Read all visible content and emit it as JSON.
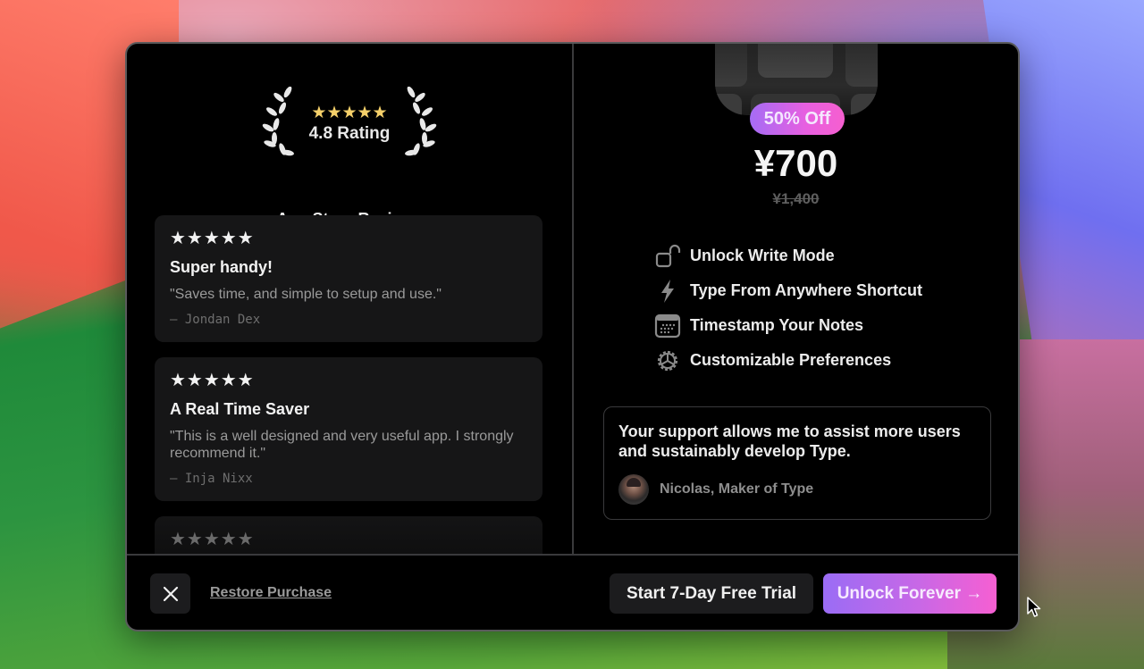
{
  "rating": {
    "stars": "★★★★★",
    "star_color": "#f5d06a",
    "value_label": "4.8 Rating",
    "source_label": "App Store Reviews"
  },
  "reviews": [
    {
      "stars": "★★★★★",
      "title": "Super handy!",
      "body": "\"Saves time, and simple to setup and use.\"",
      "author": "— Jondan Dex"
    },
    {
      "stars": "★★★★★",
      "title": "A Real Time Saver",
      "body": "\"This is a well designed and very useful app. I strongly recommend it.\"",
      "author": "— Inja Nixx"
    },
    {
      "stars": "★★★★★"
    }
  ],
  "offer": {
    "badge": "50% Off",
    "price": "¥700",
    "original_price": "¥1,400",
    "badge_gradient": [
      "#a56cf5",
      "#f65fcf"
    ]
  },
  "features": [
    {
      "icon": "unlock-icon",
      "label": "Unlock Write Mode"
    },
    {
      "icon": "bolt-icon",
      "label": "Type From Anywhere Shortcut"
    },
    {
      "icon": "calendar-icon",
      "label": "Timestamp Your Notes"
    },
    {
      "icon": "gear-icon",
      "label": "Customizable Preferences"
    }
  ],
  "support": {
    "message": "Your support allows me to assist more users and sustainably develop Type.",
    "author": "Nicolas, Maker of Type"
  },
  "footer": {
    "close_icon": "close-icon",
    "restore_label": "Restore Purchase",
    "trial_label": "Start 7-Day Free Trial",
    "unlock_label": "Unlock Forever →"
  }
}
